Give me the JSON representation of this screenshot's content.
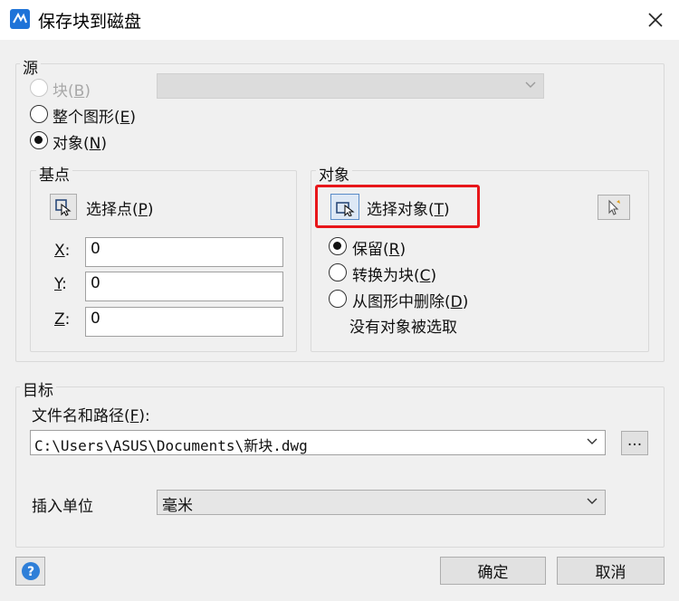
{
  "window": {
    "title": "保存块到磁盘",
    "close_icon": "close-icon",
    "app_icon": "app-logo-icon"
  },
  "source": {
    "legend": "源",
    "block_radio": {
      "text": "块(",
      "key": "B",
      "end": ")",
      "enabled": false,
      "checked": false
    },
    "block_select": {
      "value": "",
      "enabled": false
    },
    "whole_drawing_radio": {
      "text": "整个图形(",
      "key": "E",
      "end": ")",
      "checked": false
    },
    "objects_radio": {
      "text": "对象(",
      "key": "N",
      "end": ")",
      "checked": true
    }
  },
  "base_point": {
    "legend": "基点",
    "pick_button": {
      "text": "选择点(",
      "key": "P",
      "end": ")",
      "icon": "pick-point-icon"
    },
    "x": {
      "label": "X",
      "suffix": ":",
      "value": "0"
    },
    "y": {
      "label": "Y",
      "suffix": ":",
      "value": "0"
    },
    "z": {
      "label": "Z",
      "suffix": ":",
      "value": "0"
    }
  },
  "objects": {
    "legend": "对象",
    "select_button": {
      "text": "选择对象(",
      "key": "T",
      "end": ")",
      "icon": "select-objects-icon",
      "highlighted": true,
      "highlight_color": "#e8161a"
    },
    "quick_select_icon": "quick-select-icon",
    "retain_radio": {
      "text": "保留(",
      "key": "R",
      "end": ")",
      "checked": true
    },
    "convert_radio": {
      "text": "转换为块(",
      "key": "C",
      "end": ")",
      "checked": false
    },
    "delete_radio": {
      "text": "从图形中删除(",
      "key": "D",
      "end": ")",
      "checked": false
    },
    "status": "没有对象被选取"
  },
  "target": {
    "legend": "目标",
    "filename_label": {
      "text": "文件名和路径(",
      "key": "F",
      "end": "):"
    },
    "filename_value": "C:\\Users\\ASUS\\Documents\\新块.dwg",
    "browse_button": "...",
    "units_label": "插入单位",
    "units_value": "毫米"
  },
  "footer": {
    "help_icon": "help-icon",
    "ok_button": "确定",
    "cancel_button": "取消"
  },
  "colors": {
    "highlight": "#e8161a",
    "help_blue": "#2f7fd8"
  }
}
